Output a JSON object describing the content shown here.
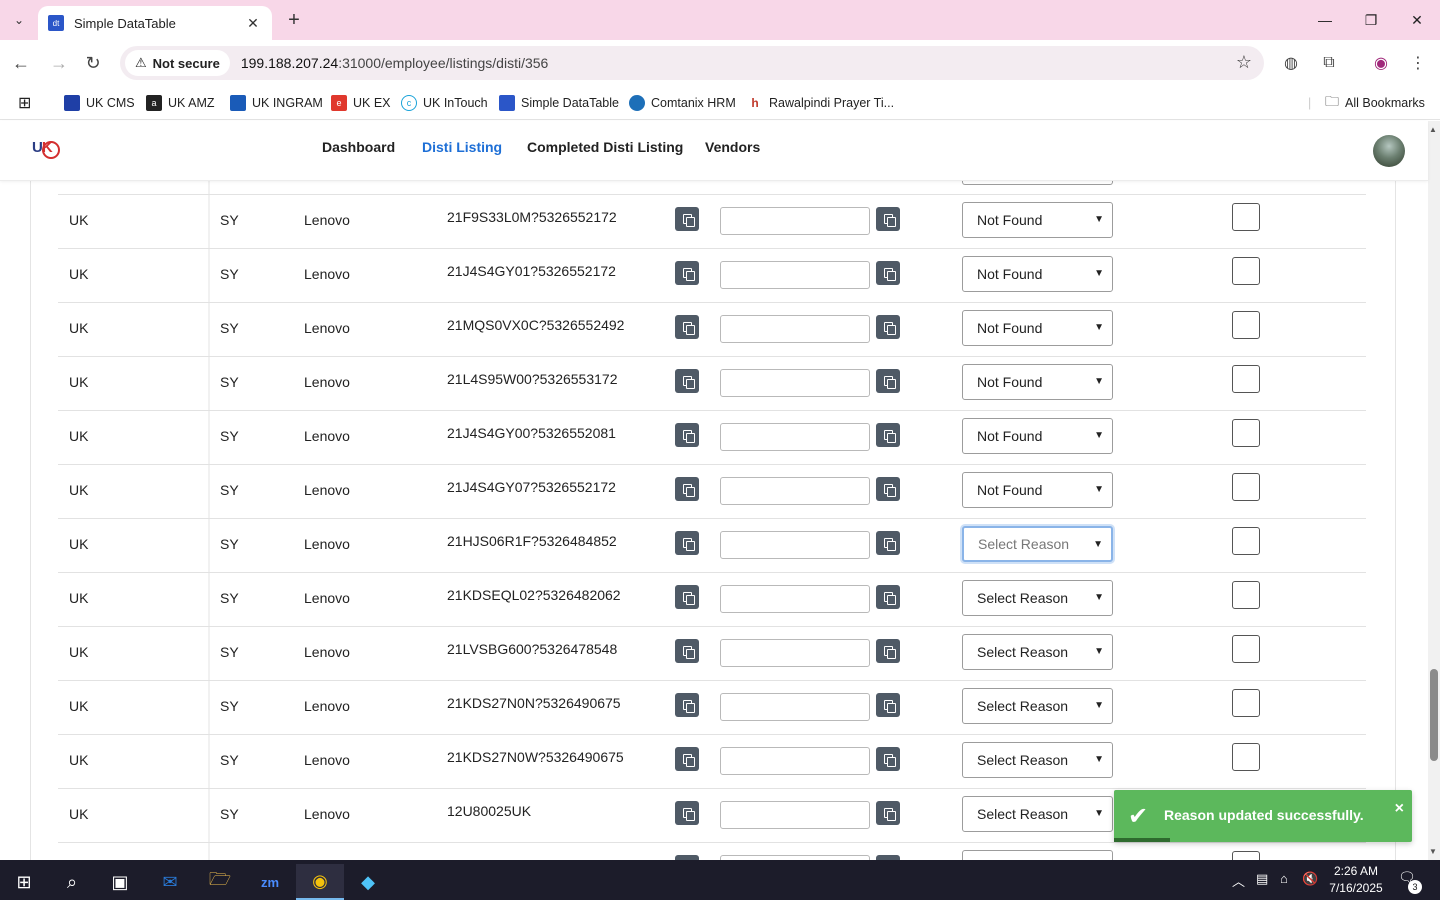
{
  "browser": {
    "tab_title": "Simple DataTable",
    "tab_favicon_text": "dt",
    "not_secure_label": "Not secure",
    "url_host": "199.188.207.24",
    "url_path": ":31000/employee/listings/disti/356",
    "bookmarks": [
      {
        "label": "UK CMS",
        "color": "#1f3fa6"
      },
      {
        "label": "UK AMZ",
        "color": "#222222"
      },
      {
        "label": "UK INGRAM",
        "color": "#1a5bb8"
      },
      {
        "label": "UK EX",
        "color": "#e0382d"
      },
      {
        "label": "UK InTouch",
        "color": "#1aa3d9"
      },
      {
        "label": "Simple DataTable",
        "color": "#2b56c8"
      },
      {
        "label": "Comtanix HRM",
        "color": "#1d6fb8"
      },
      {
        "label": "Rawalpindi Prayer Ti...",
        "color": "#c0392b"
      }
    ],
    "all_bookmarks_label": "All Bookmarks"
  },
  "nav": {
    "links": [
      "Dashboard",
      "Disti Listing",
      "Completed Disti Listing",
      "Vendors"
    ],
    "active": "Disti Listing"
  },
  "table": {
    "rows": [
      {
        "country": "UK",
        "code": "SY",
        "vendor": "Lenovo",
        "sku": "21F9S33L0M?5326552172",
        "reason": "Not Found"
      },
      {
        "country": "UK",
        "code": "SY",
        "vendor": "Lenovo",
        "sku": "21J4S4GY01?5326552172",
        "reason": "Not Found"
      },
      {
        "country": "UK",
        "code": "SY",
        "vendor": "Lenovo",
        "sku": "21MQS0VX0C?5326552492",
        "reason": "Not Found"
      },
      {
        "country": "UK",
        "code": "SY",
        "vendor": "Lenovo",
        "sku": "21L4S95W00?5326553172",
        "reason": "Not Found"
      },
      {
        "country": "UK",
        "code": "SY",
        "vendor": "Lenovo",
        "sku": "21J4S4GY00?5326552081",
        "reason": "Not Found"
      },
      {
        "country": "UK",
        "code": "SY",
        "vendor": "Lenovo",
        "sku": "21J4S4GY07?5326552172",
        "reason": "Not Found"
      },
      {
        "country": "UK",
        "code": "SY",
        "vendor": "Lenovo",
        "sku": "21HJS06R1F?5326484852",
        "reason": "Select Reason"
      },
      {
        "country": "UK",
        "code": "SY",
        "vendor": "Lenovo",
        "sku": "21KDSEQL02?5326482062",
        "reason": "Select Reason"
      },
      {
        "country": "UK",
        "code": "SY",
        "vendor": "Lenovo",
        "sku": "21LVSBG600?5326478548",
        "reason": "Select Reason"
      },
      {
        "country": "UK",
        "code": "SY",
        "vendor": "Lenovo",
        "sku": "21KDS27N0N?5326490675",
        "reason": "Select Reason"
      },
      {
        "country": "UK",
        "code": "SY",
        "vendor": "Lenovo",
        "sku": "21KDS27N0W?5326490675",
        "reason": "Select Reason"
      },
      {
        "country": "UK",
        "code": "SY",
        "vendor": "Lenovo",
        "sku": "12U80025UK",
        "reason": "Select Reason"
      }
    ],
    "focused_row_index": 6
  },
  "toast": {
    "message": "Reason updated successfully.",
    "close_glyph": "×",
    "color": "#5cb85c"
  },
  "taskbar": {
    "time": "2:26 AM",
    "date": "7/16/2025",
    "notification_count": "3"
  }
}
